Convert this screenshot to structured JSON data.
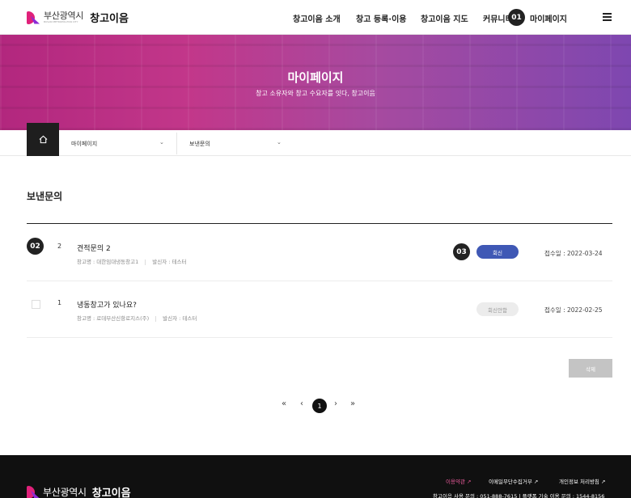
{
  "header": {
    "logo_city": "부산광역시",
    "logo_sub": "BUSAN METROPOLITAN CITY",
    "logo_brand": "창고이음",
    "nav": [
      "창고이음 소개",
      "창고 등록·이용",
      "창고이음 지도",
      "커뮤니티",
      "마이페이지"
    ],
    "step1": "01"
  },
  "banner": {
    "title": "마이페이지",
    "subtitle": "창고 소유자와 창고 수요자를 잇다, 창고이음"
  },
  "breadcrumb": {
    "level1": "마이페이지",
    "level2": "보낸문의"
  },
  "main": {
    "title": "보낸문의",
    "step2": "02",
    "step3": "03",
    "rows": [
      {
        "number": "2",
        "subject": "견적문의 2",
        "warehouse": "창고명 : 대한임대냉동창고1",
        "sender": "발신자 : 테스터",
        "status": "회신",
        "date": "접수일 : 2022-03-24"
      },
      {
        "number": "1",
        "subject": "냉동창고가 있나요?",
        "warehouse": "창고명 : 로데부산신항로지스(주)",
        "sender": "발신자 : 테스터",
        "status": "회신안함",
        "date": "접수일 : 2022-02-25"
      }
    ],
    "delete_label": "삭제",
    "pagination": {
      "first": "«",
      "prev": "‹",
      "current": "1",
      "next": "›",
      "last": "»"
    }
  },
  "footer": {
    "logo_city": "부산광역시",
    "logo_brand": "창고이음",
    "links": [
      "이용약관",
      "이메일무단수집거부",
      "개인정보 처리방침"
    ],
    "contact": "창고이음 사용 문의 : 051-888-7615  |  플랫폼 기술 이용 문의 : 1544-8156"
  },
  "colors": {
    "accent_pink": "#e0217a",
    "replied_badge": "#3f58b5",
    "footer_bg": "#101010"
  }
}
